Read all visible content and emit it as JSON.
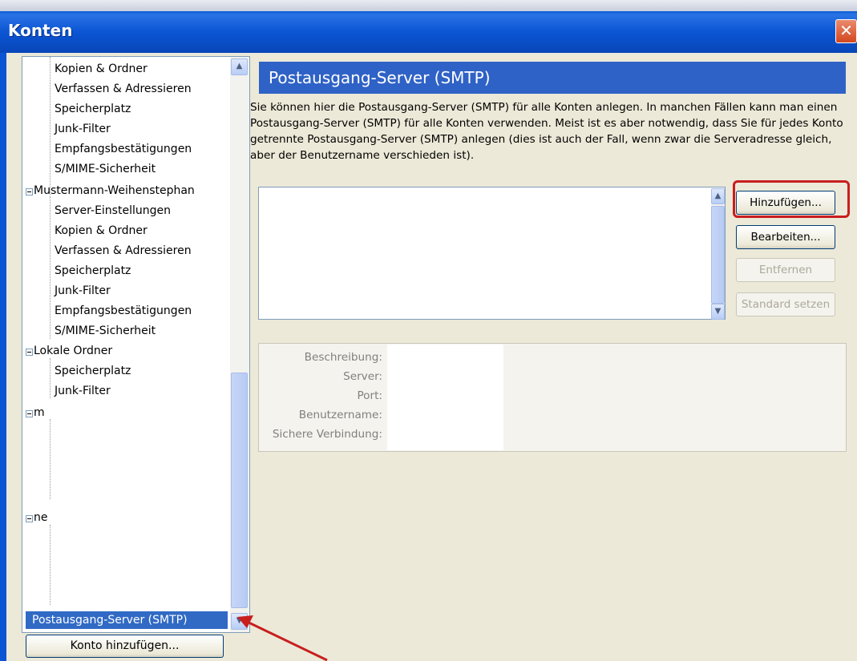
{
  "window": {
    "title": "Konten",
    "close_glyph": "✕"
  },
  "tree": {
    "items": [
      {
        "label": "Kopien & Ordner",
        "level": 1
      },
      {
        "label": "Verfassen & Adressieren",
        "level": 1
      },
      {
        "label": "Speicherplatz",
        "level": 1
      },
      {
        "label": "Junk-Filter",
        "level": 1
      },
      {
        "label": "Empfangsbestätigungen",
        "level": 1
      },
      {
        "label": "S/MIME-Sicherheit",
        "level": 1
      },
      {
        "label": "Mustermann-Weihenstephan",
        "level": 0
      },
      {
        "label": "Server-Einstellungen",
        "level": 1
      },
      {
        "label": "Kopien & Ordner",
        "level": 1
      },
      {
        "label": "Verfassen & Adressieren",
        "level": 1
      },
      {
        "label": "Speicherplatz",
        "level": 1
      },
      {
        "label": "Junk-Filter",
        "level": 1
      },
      {
        "label": "Empfangsbestätigungen",
        "level": 1
      },
      {
        "label": "S/MIME-Sicherheit",
        "level": 1
      },
      {
        "label": "Lokale Ordner",
        "level": 0
      },
      {
        "label": "Speicherplatz",
        "level": 1
      },
      {
        "label": "Junk-Filter",
        "level": 1
      },
      {
        "label": "m",
        "level": 0
      },
      {
        "label": "ne",
        "level": 0
      }
    ],
    "selected": "Postausgang-Server (SMTP)"
  },
  "add_account_button": "Konto hinzufügen...",
  "main": {
    "heading": "Postausgang-Server (SMTP)",
    "description": "Sie können hier die Postausgang-Server (SMTP) für alle Konten anlegen. In manchen Fällen kann man einen Postausgang-Server (SMTP) für alle Konten verwenden. Meist ist es aber notwendig, dass Sie für jedes Konto getrennte Postausgang-Server (SMTP) anlegen (dies ist auch der Fall, wenn zwar die Serveradresse gleich, aber der Benutzername verschieden ist).",
    "buttons": {
      "add": "Hinzufügen...",
      "edit": "Bearbeiten...",
      "remove": "Entfernen",
      "set_default": "Standard setzen"
    },
    "details": {
      "description_label": "Beschreibung:",
      "server_label": "Server:",
      "port_label": "Port:",
      "username_label": "Benutzername:",
      "secure_label": "Sichere Verbindung:"
    }
  },
  "colors": {
    "highlight_box": "#c81e1e",
    "heading_bg": "#2f62c6",
    "selection_bg": "#316ac5"
  }
}
